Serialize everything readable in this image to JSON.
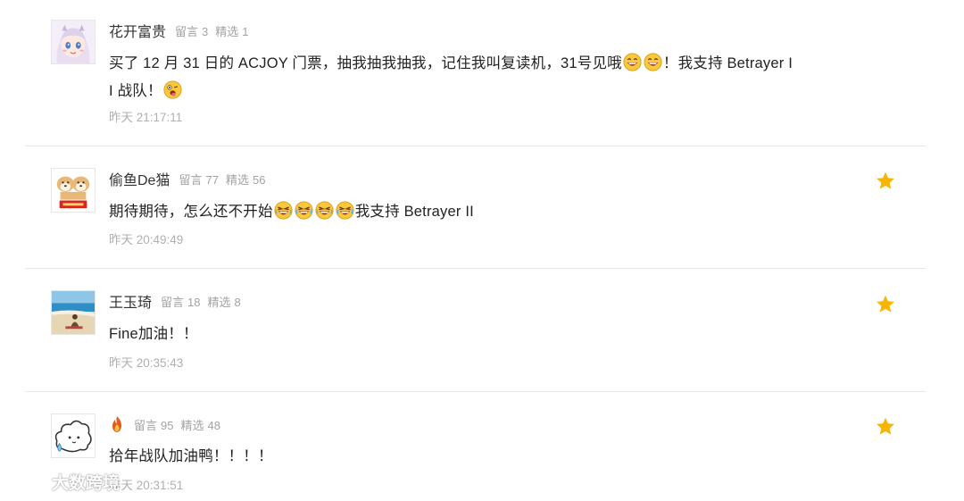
{
  "labels": {
    "comments_label": "留言",
    "featured_label": "精选"
  },
  "colors": {
    "star": "#f7b500",
    "text": "#222222",
    "meta": "#a3a3a3"
  },
  "comments": [
    {
      "nickname": "花开富贵",
      "comments_count": "3",
      "featured_count": "1",
      "content_line1": "买了 12 月 31 日的 ACJOY 门票，抽我抽我抽我，记住我叫复读机，31号见哦",
      "content_line1_tail": "！我支持 Betrayer I",
      "content_line2": "I 战队！",
      "time": "昨天 21:17:11",
      "starred": false
    },
    {
      "nickname": "偷鱼De猫",
      "comments_count": "77",
      "featured_count": "56",
      "content": "期待期待，怎么还不开始",
      "content_tail": "我支持 Betrayer II",
      "time": "昨天 20:49:49",
      "starred": true
    },
    {
      "nickname": "王玉琦",
      "comments_count": "18",
      "featured_count": "8",
      "content": "Fine加油！！",
      "time": "昨天 20:35:43",
      "starred": true
    },
    {
      "nickname": "",
      "nickname_icon": "fire-icon",
      "comments_count": "95",
      "featured_count": "48",
      "content": "拾年战队加油鸭！！！！",
      "time": "昨天 20:31:51",
      "starred": true
    }
  ],
  "watermark": {
    "text": "大数跨境"
  }
}
